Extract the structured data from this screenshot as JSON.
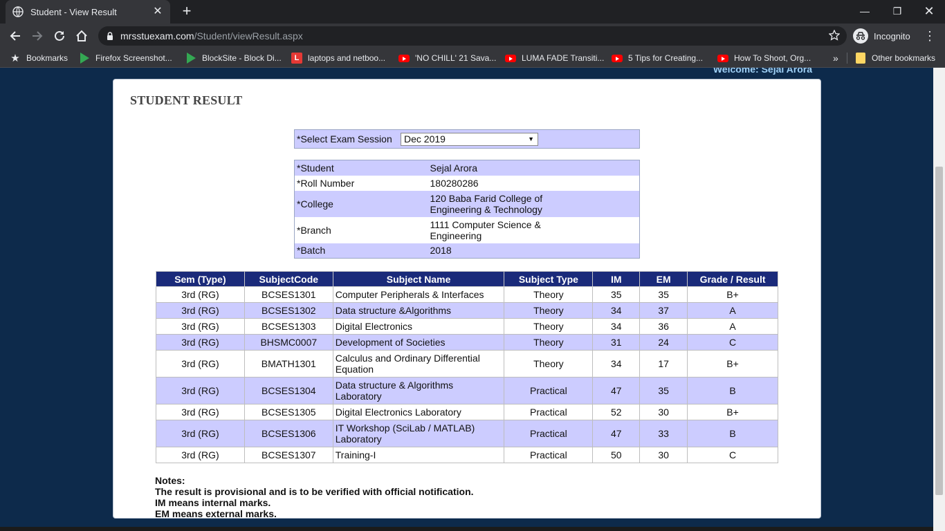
{
  "browser": {
    "tab_title": "Student - View Result",
    "url_host": "mrsstuexam.com",
    "url_path": "/Student/viewResult.aspx",
    "profile_label": "Incognito",
    "bookmarks": [
      {
        "label": "Bookmarks",
        "icon": "star-icon"
      },
      {
        "label": "Firefox Screenshot...",
        "icon": "play-store-icon"
      },
      {
        "label": "BlockSite - Block Di...",
        "icon": "play-store-icon"
      },
      {
        "label": "laptops and netboo...",
        "icon": "l-letter-icon"
      },
      {
        "label": "'NO CHILL' 21 Sava...",
        "icon": "youtube-icon"
      },
      {
        "label": "LUMA FADE Transiti...",
        "icon": "youtube-icon"
      },
      {
        "label": "5 Tips for Creating...",
        "icon": "youtube-icon"
      },
      {
        "label": "How To Shoot, Org...",
        "icon": "youtube-icon"
      },
      {
        "label": "Other bookmarks",
        "icon": "folder-icon"
      }
    ],
    "overflow_label": "»"
  },
  "page": {
    "welcome": "Welcome: Sejal Arora",
    "title": "STUDENT RESULT",
    "session_label": "*Select Exam Session",
    "session_value": "Dec 2019",
    "student_info": [
      {
        "label": "*Student",
        "value": "Sejal Arora"
      },
      {
        "label": "*Roll Number",
        "value": "180280286"
      },
      {
        "label": "*College",
        "value_line1": "120 Baba Farid College of",
        "value_line2": "Engineering & Technology"
      },
      {
        "label": "*Branch",
        "value_line1": "1111 Computer Science &",
        "value_line2": "Engineering"
      },
      {
        "label": "*Batch",
        "value": "2018"
      }
    ],
    "results_headers": [
      "Sem (Type)",
      "SubjectCode",
      "Subject Name",
      "Subject Type",
      "IM",
      "EM",
      "Grade / Result"
    ],
    "results_rows": [
      {
        "sem": "3rd (RG)",
        "code": "BCSES1301",
        "name1": "Computer Peripherals & Interfaces",
        "name2": "",
        "type": "Theory",
        "im": "35",
        "em": "35",
        "grade": "B+"
      },
      {
        "sem": "3rd (RG)",
        "code": "BCSES1302",
        "name1": "Data structure &Algorithms",
        "name2": "",
        "type": "Theory",
        "im": "34",
        "em": "37",
        "grade": "A"
      },
      {
        "sem": "3rd (RG)",
        "code": "BCSES1303",
        "name1": "Digital Electronics",
        "name2": "",
        "type": "Theory",
        "im": "34",
        "em": "36",
        "grade": "A"
      },
      {
        "sem": "3rd (RG)",
        "code": "BHSMC0007",
        "name1": "Development of Societies",
        "name2": "",
        "type": "Theory",
        "im": "31",
        "em": "24",
        "grade": "C"
      },
      {
        "sem": "3rd (RG)",
        "code": "BMATH1301",
        "name1": "Calculus and Ordinary Differential",
        "name2": "Equation",
        "type": "Theory",
        "im": "34",
        "em": "17",
        "grade": "B+"
      },
      {
        "sem": "3rd (RG)",
        "code": "BCSES1304",
        "name1": "Data structure & Algorithms",
        "name2": "Laboratory",
        "type": "Practical",
        "im": "47",
        "em": "35",
        "grade": "B"
      },
      {
        "sem": "3rd (RG)",
        "code": "BCSES1305",
        "name1": "Digital Electronics Laboratory",
        "name2": "",
        "type": "Practical",
        "im": "52",
        "em": "30",
        "grade": "B+"
      },
      {
        "sem": "3rd (RG)",
        "code": "BCSES1306",
        "name1": "IT Workshop (SciLab / MATLAB)",
        "name2": "Laboratory",
        "type": "Practical",
        "im": "47",
        "em": "33",
        "grade": "B"
      },
      {
        "sem": "3rd (RG)",
        "code": "BCSES1307",
        "name1": "Training-I",
        "name2": "",
        "type": "Practical",
        "im": "50",
        "em": "30",
        "grade": "C"
      }
    ],
    "notes": [
      "Notes:",
      "The result is provisional and is to be verified with official notification.",
      "IM means internal marks.",
      "EM means external marks."
    ]
  }
}
